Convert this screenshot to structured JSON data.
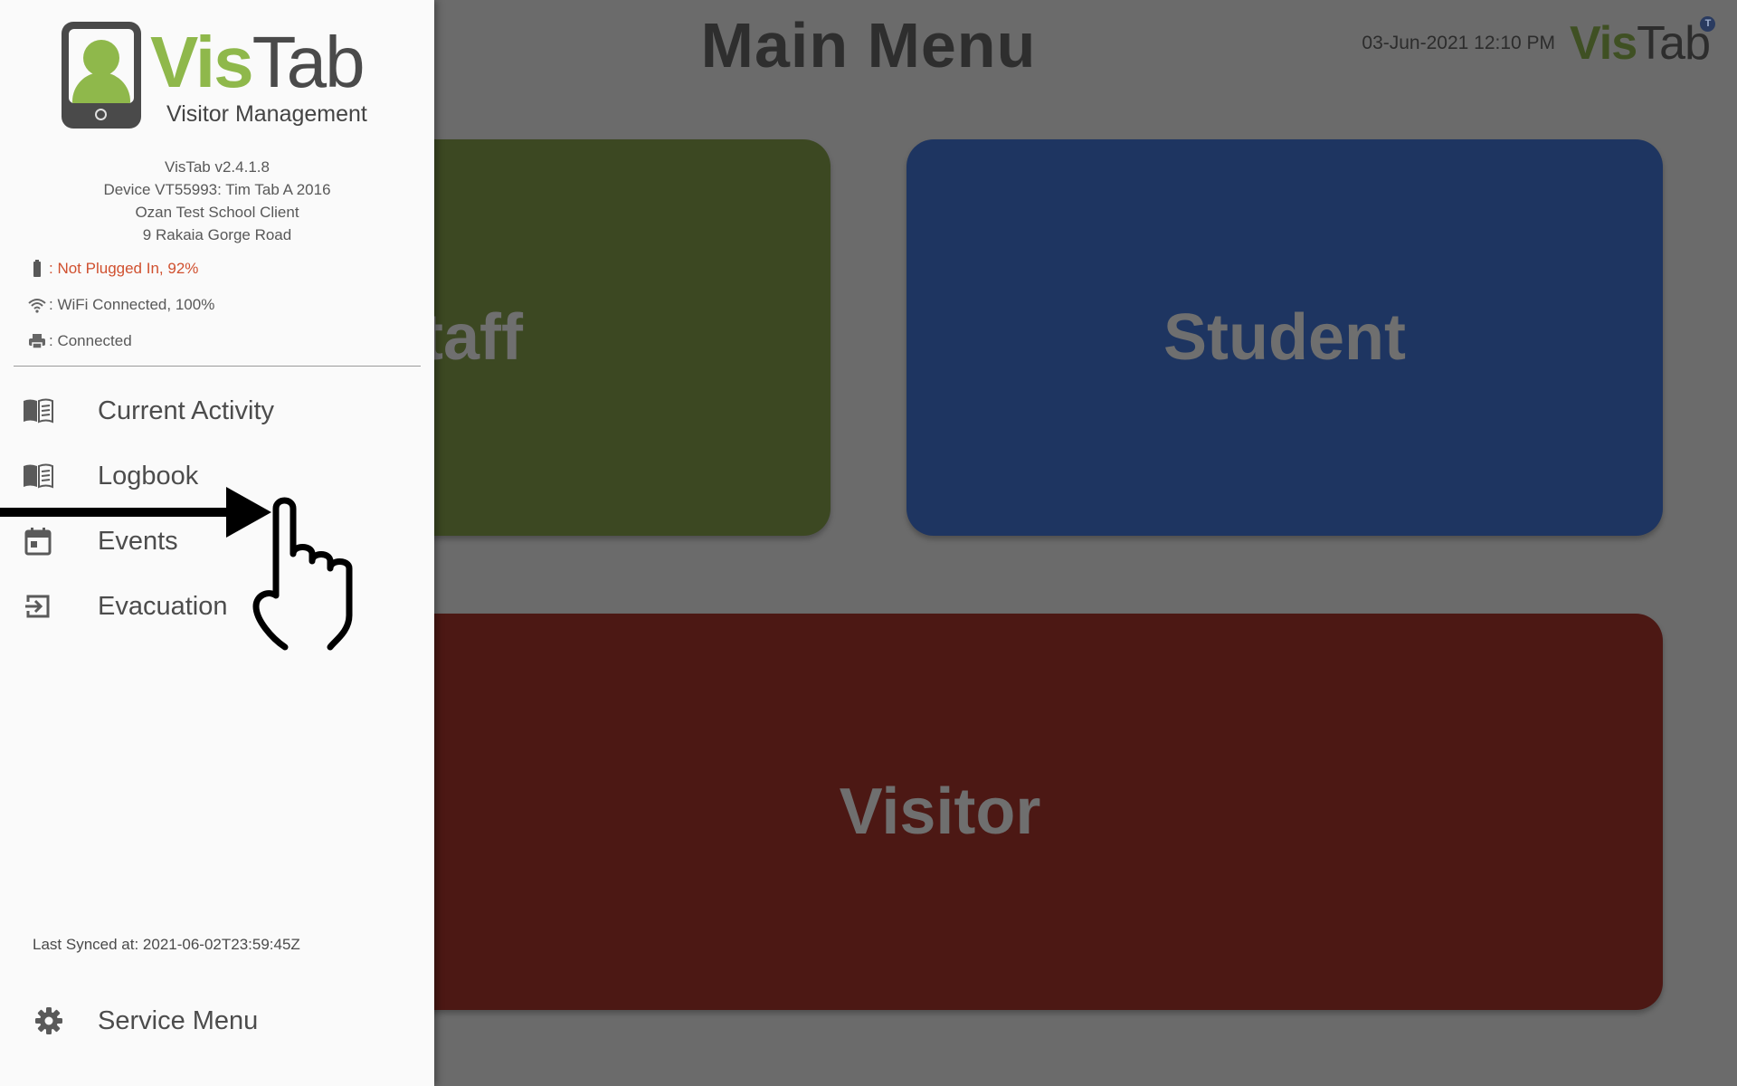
{
  "main": {
    "title": "Main Menu",
    "datetime": "03-Jun-2021 12:10 PM",
    "logo_vis": "Vis",
    "logo_tab": "Tab",
    "logo_badge": "T",
    "tiles": {
      "staff": "taff",
      "student": "Student",
      "visitor": "Visitor"
    },
    "colors": {
      "staff": "#3c4822",
      "student": "#1e3561",
      "visitor": "#4c1814"
    }
  },
  "drawer": {
    "logo_vis": "Vis",
    "logo_tab": "Tab",
    "logo_subtitle": "Visitor Management",
    "version": "VisTab v2.4.1.8",
    "device": "Device VT55993: Tim Tab A 2016",
    "client": "Ozan Test School Client",
    "address": "9 Rakaia Gorge Road",
    "battery_status": ": Not Plugged In, 92%",
    "wifi_status": ": WiFi Connected, 100%",
    "printer_status": ": Connected",
    "items": [
      {
        "label": "Current Activity",
        "icon": "book-icon"
      },
      {
        "label": "Logbook",
        "icon": "book-icon"
      },
      {
        "label": "Events",
        "icon": "calendar-icon"
      },
      {
        "label": "Evacuation",
        "icon": "exit-icon"
      }
    ],
    "last_synced": "Last Synced at: 2021-06-02T23:59:45Z",
    "service_menu": "Service Menu",
    "accent_color": "#8fb84b",
    "warning_color": "#d0502f"
  }
}
